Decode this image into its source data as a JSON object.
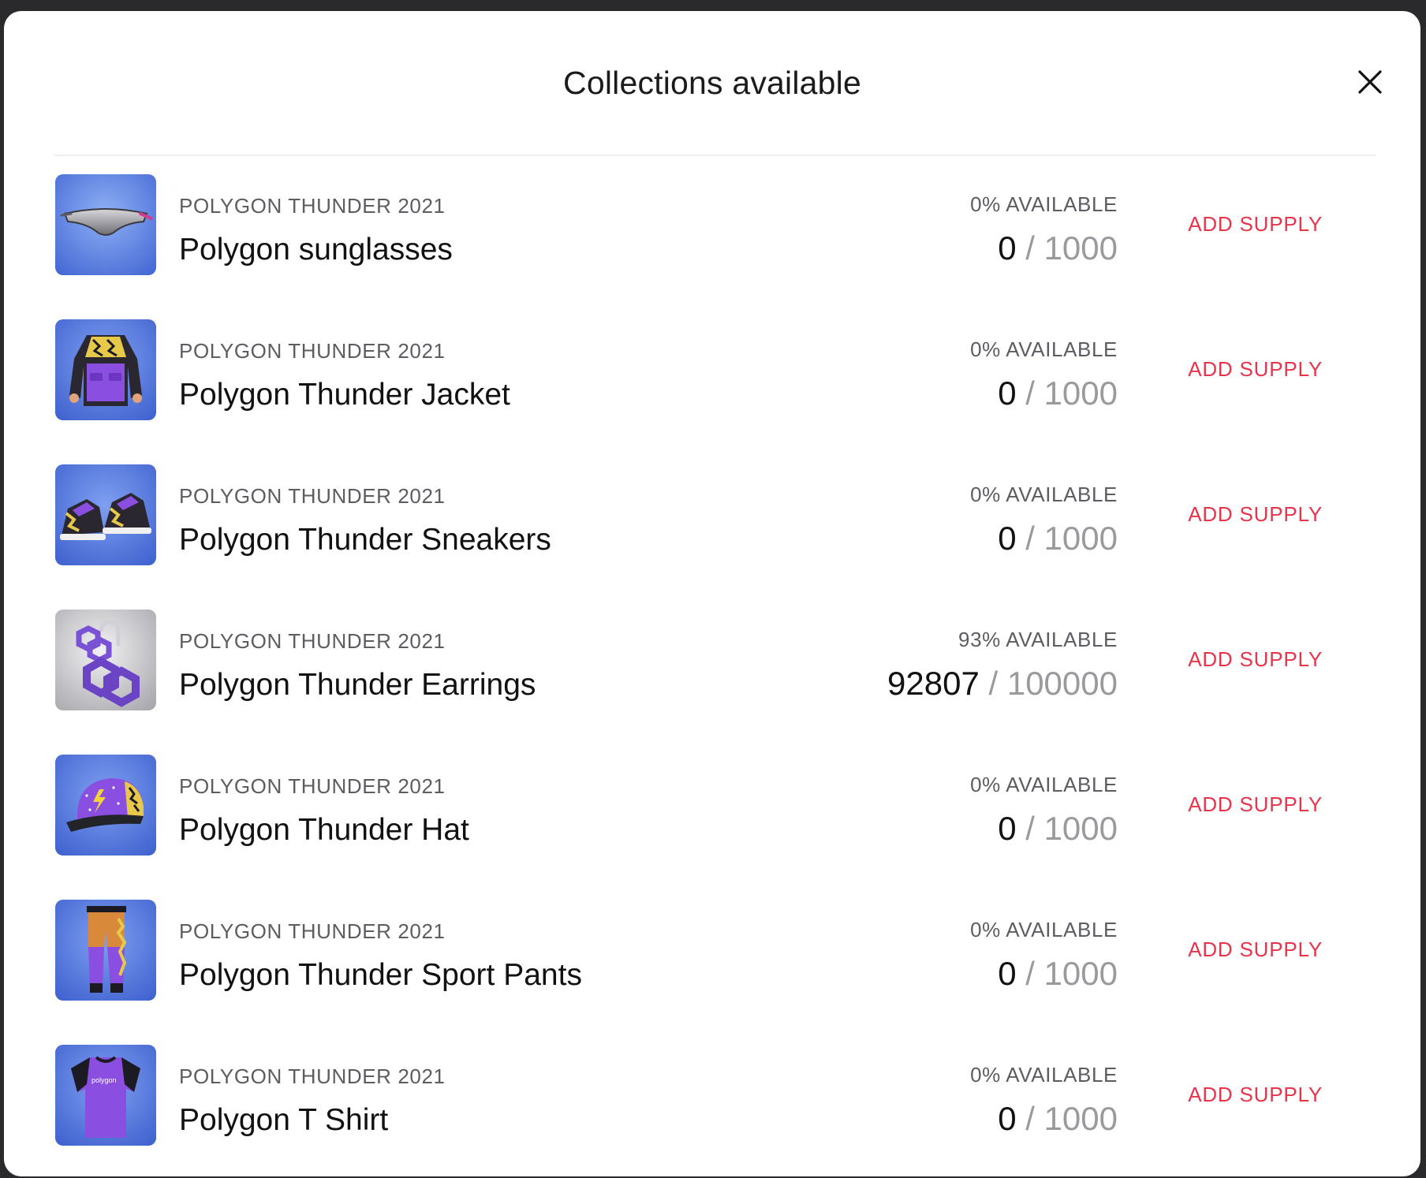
{
  "modal": {
    "title": "Collections available",
    "close_label": "close"
  },
  "items": [
    {
      "collection": "POLYGON THUNDER 2021",
      "name": "Polygon sunglasses",
      "availability": "0% AVAILABLE",
      "current": "0",
      "separator": "/",
      "total": "1000",
      "action": "ADD SUPPLY",
      "thumbnail": "sunglasses-thumbnail"
    },
    {
      "collection": "POLYGON THUNDER 2021",
      "name": "Polygon Thunder Jacket",
      "availability": "0% AVAILABLE",
      "current": "0",
      "separator": "/",
      "total": "1000",
      "action": "ADD SUPPLY",
      "thumbnail": "jacket-thumbnail"
    },
    {
      "collection": "POLYGON THUNDER 2021",
      "name": "Polygon Thunder Sneakers",
      "availability": "0% AVAILABLE",
      "current": "0",
      "separator": "/",
      "total": "1000",
      "action": "ADD SUPPLY",
      "thumbnail": "sneakers-thumbnail"
    },
    {
      "collection": "POLYGON THUNDER 2021",
      "name": "Polygon Thunder Earrings",
      "availability": "93% AVAILABLE",
      "current": "92807",
      "separator": "/",
      "total": "100000",
      "action": "ADD SUPPLY",
      "thumbnail": "earrings-thumbnail"
    },
    {
      "collection": "POLYGON THUNDER 2021",
      "name": "Polygon Thunder Hat",
      "availability": "0% AVAILABLE",
      "current": "0",
      "separator": "/",
      "total": "1000",
      "action": "ADD SUPPLY",
      "thumbnail": "hat-thumbnail"
    },
    {
      "collection": "POLYGON THUNDER 2021",
      "name": "Polygon Thunder Sport Pants",
      "availability": "0% AVAILABLE",
      "current": "0",
      "separator": "/",
      "total": "1000",
      "action": "ADD SUPPLY",
      "thumbnail": "pants-thumbnail"
    },
    {
      "collection": "POLYGON THUNDER 2021",
      "name": "Polygon T Shirt",
      "availability": "0% AVAILABLE",
      "current": "0",
      "separator": "/",
      "total": "1000",
      "action": "ADD SUPPLY",
      "thumbnail": "tshirt-thumbnail",
      "thumbnail_text": "polygon"
    }
  ],
  "colors": {
    "accent": "#e8344a",
    "thumbnail_blue": "#4a72d8",
    "thumbnail_gray": "#c9c9cc",
    "item_purple": "#8a4fe0"
  }
}
